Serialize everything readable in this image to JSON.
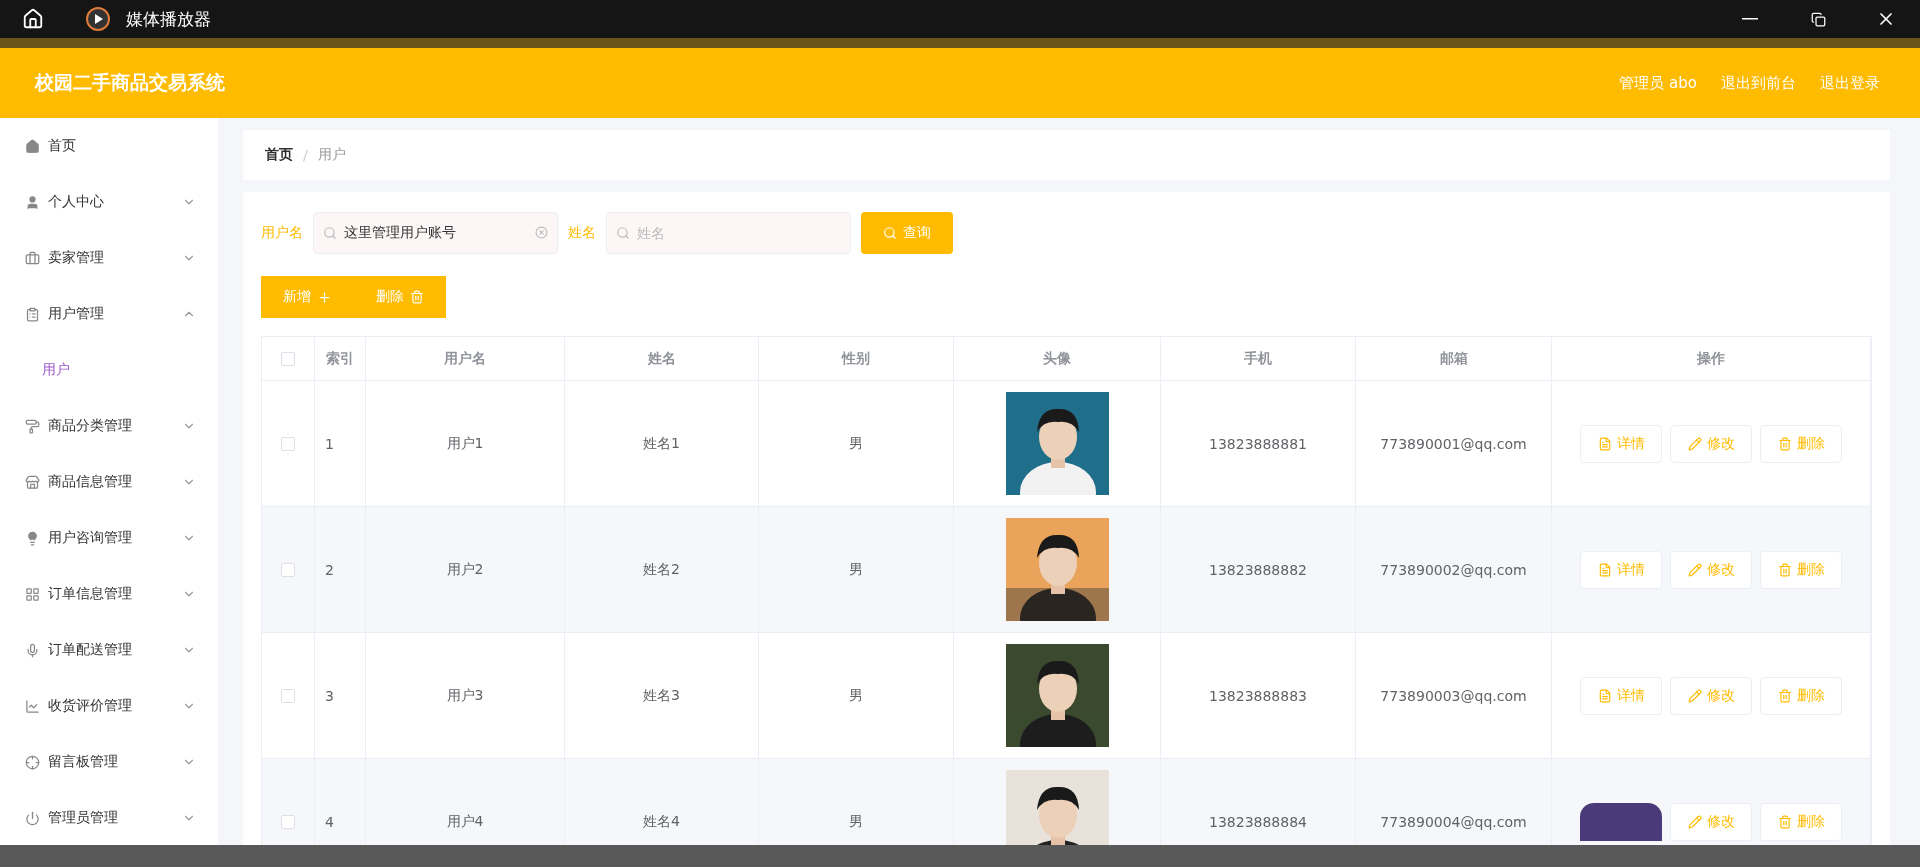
{
  "player": {
    "title": "媒体播放器"
  },
  "app": {
    "title": "校园二手商品交易系统",
    "user": "管理员 abo",
    "links": [
      "退出到前台",
      "退出登录"
    ]
  },
  "sidebar": {
    "items": [
      {
        "kind": "link",
        "label": "首页"
      },
      {
        "kind": "menu",
        "label": "个人中心",
        "expanded": false
      },
      {
        "kind": "menu",
        "label": "卖家管理",
        "expanded": false
      },
      {
        "kind": "menu",
        "label": "用户管理",
        "expanded": true,
        "children": [
          {
            "label": "用户",
            "selected": true
          }
        ]
      },
      {
        "kind": "menu",
        "label": "商品分类管理",
        "expanded": false
      },
      {
        "kind": "menu",
        "label": "商品信息管理",
        "expanded": false
      },
      {
        "kind": "menu",
        "label": "用户咨询管理",
        "expanded": false
      },
      {
        "kind": "menu",
        "label": "订单信息管理",
        "expanded": false
      },
      {
        "kind": "menu",
        "label": "订单配送管理",
        "expanded": false
      },
      {
        "kind": "menu",
        "label": "收货评价管理",
        "expanded": false
      },
      {
        "kind": "menu",
        "label": "留言板管理",
        "expanded": false
      },
      {
        "kind": "menu",
        "label": "管理员管理",
        "expanded": false
      }
    ]
  },
  "breadcrumb": {
    "items": [
      "首页",
      "用户"
    ],
    "separator": "/"
  },
  "search": {
    "fields": [
      {
        "label": "用户名",
        "value": "这里管理用户账号"
      },
      {
        "label": "姓名",
        "placeholder": "姓名"
      }
    ],
    "button": "查询"
  },
  "toolbar": [
    {
      "kind": "add",
      "label": "新增"
    },
    {
      "kind": "delete",
      "label": "删除"
    }
  ],
  "table": {
    "select_all": {
      "checked": false
    },
    "columns": [
      "索引",
      "用户名",
      "姓名",
      "性别",
      "头像",
      "手机",
      "邮箱",
      "操作"
    ],
    "rows": [
      {
        "checked": false,
        "index": "1",
        "username": "用户1",
        "name": "姓名1",
        "gender": "男",
        "phone": "13823888881",
        "email": "773890001@qq.com",
        "actions": [
          {
            "kind": "detail",
            "label": "详情"
          },
          {
            "kind": "edit",
            "label": "修改"
          },
          {
            "kind": "delete",
            "label": "删除"
          }
        ]
      },
      {
        "checked": false,
        "index": "2",
        "username": "用户2",
        "name": "姓名2",
        "gender": "男",
        "phone": "13823888882",
        "email": "773890002@qq.com",
        "actions": [
          {
            "kind": "detail",
            "label": "详情"
          },
          {
            "kind": "edit",
            "label": "修改"
          },
          {
            "kind": "delete",
            "label": "删除"
          }
        ]
      },
      {
        "checked": false,
        "index": "3",
        "username": "用户3",
        "name": "姓名3",
        "gender": "男",
        "phone": "13823888883",
        "email": "773890003@qq.com",
        "actions": [
          {
            "kind": "detail",
            "label": "详情"
          },
          {
            "kind": "edit",
            "label": "修改"
          },
          {
            "kind": "delete",
            "label": "删除"
          }
        ]
      },
      {
        "checked": false,
        "index": "4",
        "username": "用户4",
        "name": "姓名4",
        "gender": "男",
        "phone": "13823888884",
        "email": "773890004@qq.com",
        "actions": [
          {
            "kind": "overlay"
          },
          {
            "kind": "edit",
            "label": "修改"
          },
          {
            "kind": "delete",
            "label": "删除"
          }
        ]
      }
    ]
  }
}
